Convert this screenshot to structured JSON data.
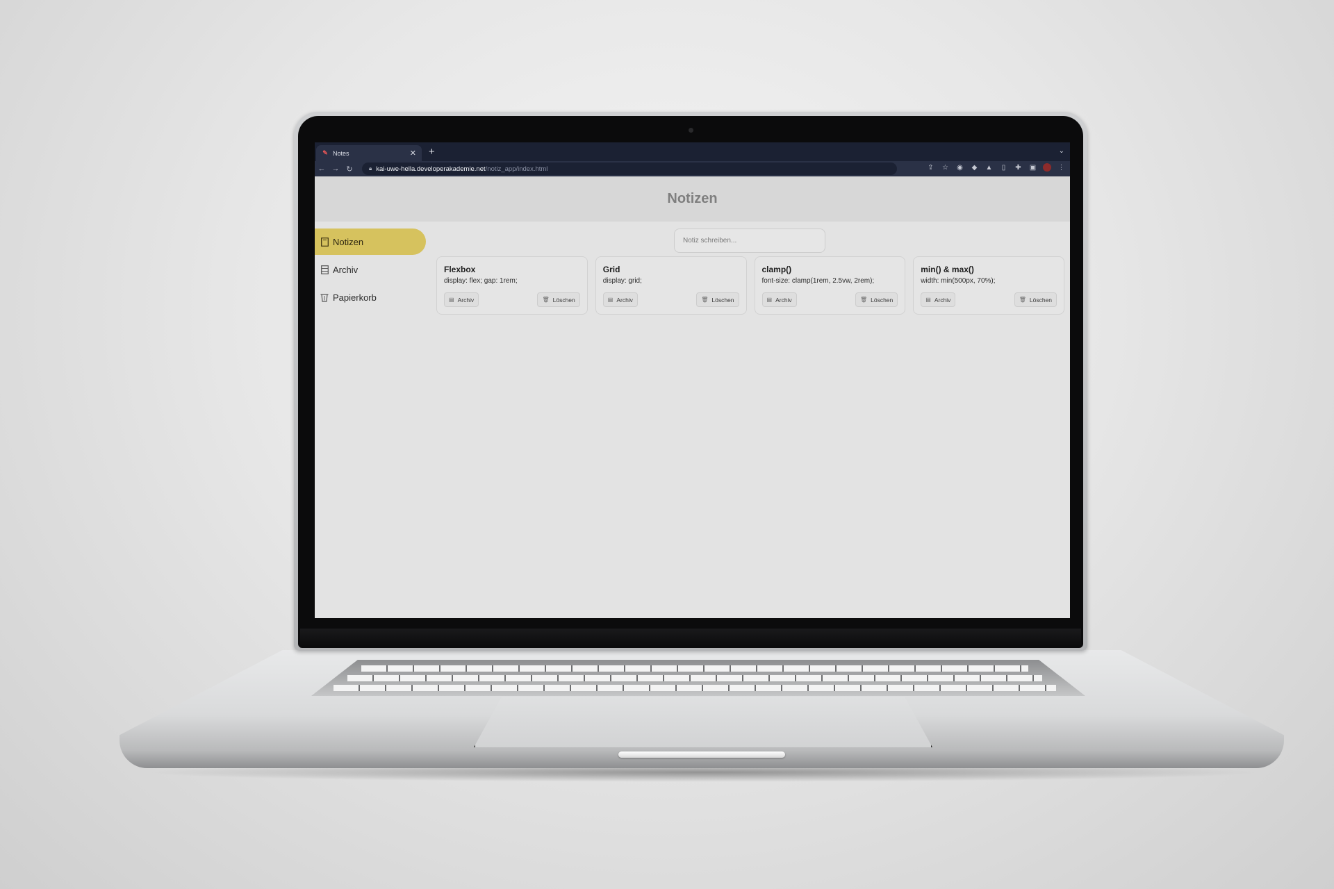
{
  "browser": {
    "tab_title": "Notes",
    "tab_favicon": "notes-favicon",
    "new_tab_symbol": "+",
    "url_host": "kai-uwe-hella.developerakademie.net",
    "url_path": "/notiz_app/index.html"
  },
  "app": {
    "title": "Notizen",
    "accent_color": "#d6c25e",
    "input_placeholder": "Notiz schreiben...",
    "sidebar": {
      "items": [
        {
          "label": "Notizen",
          "icon": "note-icon",
          "active": true
        },
        {
          "label": "Archiv",
          "icon": "archive-icon",
          "active": false
        },
        {
          "label": "Papierkorb",
          "icon": "trash-icon",
          "active": false
        }
      ]
    },
    "notes": [
      {
        "title": "Flexbox",
        "text": "display: flex; gap: 1rem;",
        "archive_label": "Archiv",
        "delete_label": "Löschen"
      },
      {
        "title": "Grid",
        "text": "display: grid;",
        "archive_label": "Archiv",
        "delete_label": "Löschen"
      },
      {
        "title": "clamp()",
        "text": "font-size: clamp(1rem, 2.5vw, 2rem);",
        "archive_label": "Archiv",
        "delete_label": "Löschen"
      },
      {
        "title": "min() & max()",
        "text": "width: min(500px, 70%);",
        "archive_label": "Archiv",
        "delete_label": "Löschen"
      }
    ]
  }
}
